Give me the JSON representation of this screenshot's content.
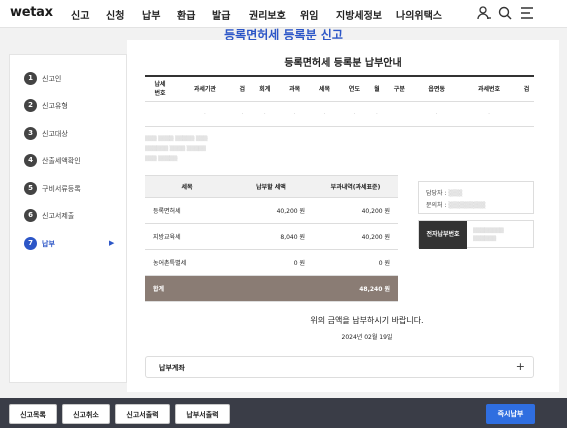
{
  "app": {
    "logo": "wetax"
  },
  "nav": [
    "신고",
    "신청",
    "납부",
    "환급",
    "발급",
    "권리보호",
    "위임",
    "지방세정보",
    "나의위택스"
  ],
  "page_title": "등록면허세 등록분 신고",
  "steps": [
    {
      "num": "1",
      "label": "신고인"
    },
    {
      "num": "2",
      "label": "신고유형"
    },
    {
      "num": "3",
      "label": "신고대상"
    },
    {
      "num": "4",
      "label": "산출세액확인"
    },
    {
      "num": "5",
      "label": "구비서류등록"
    },
    {
      "num": "6",
      "label": "신고서제출"
    },
    {
      "num": "7",
      "label": "납부",
      "arrow": "▶"
    }
  ],
  "section_title": "등록면허세 등록분 납부안내",
  "bill_table": {
    "headers": [
      "납세\n번호",
      "과세기관",
      "검",
      "회계",
      "과목",
      "세목",
      "연도",
      "월",
      "구분",
      "읍면동",
      "과세번호",
      "검"
    ]
  },
  "tax_table": {
    "headers": [
      "세목",
      "납부할 세액",
      "부과내역(과세표준)"
    ],
    "rows": [
      {
        "item": "등록면허세",
        "amount": "40,200 원",
        "base": "40,200 원"
      },
      {
        "item": "지방교육세",
        "amount": "8,040 원",
        "base": "40,200 원"
      },
      {
        "item": "농어촌특별세",
        "amount": "0 원",
        "base": "0 원"
      }
    ],
    "total_label": "합계",
    "total_amount": "48,240 원"
  },
  "contact": {
    "manager_label": "담당자 :",
    "phone_label": "문의처 :"
  },
  "virtual_account": {
    "label": "전자납부번호"
  },
  "notice": "위의 금액을 납부하시기 바랍니다.",
  "date": "2024년 02월 19일",
  "account_section": {
    "label": "납부계좌",
    "toggle": "+"
  },
  "bottom_buttons": [
    "신고목록",
    "신고취소",
    "신고서출력",
    "납부서출력"
  ],
  "pay_button": "즉시납부"
}
